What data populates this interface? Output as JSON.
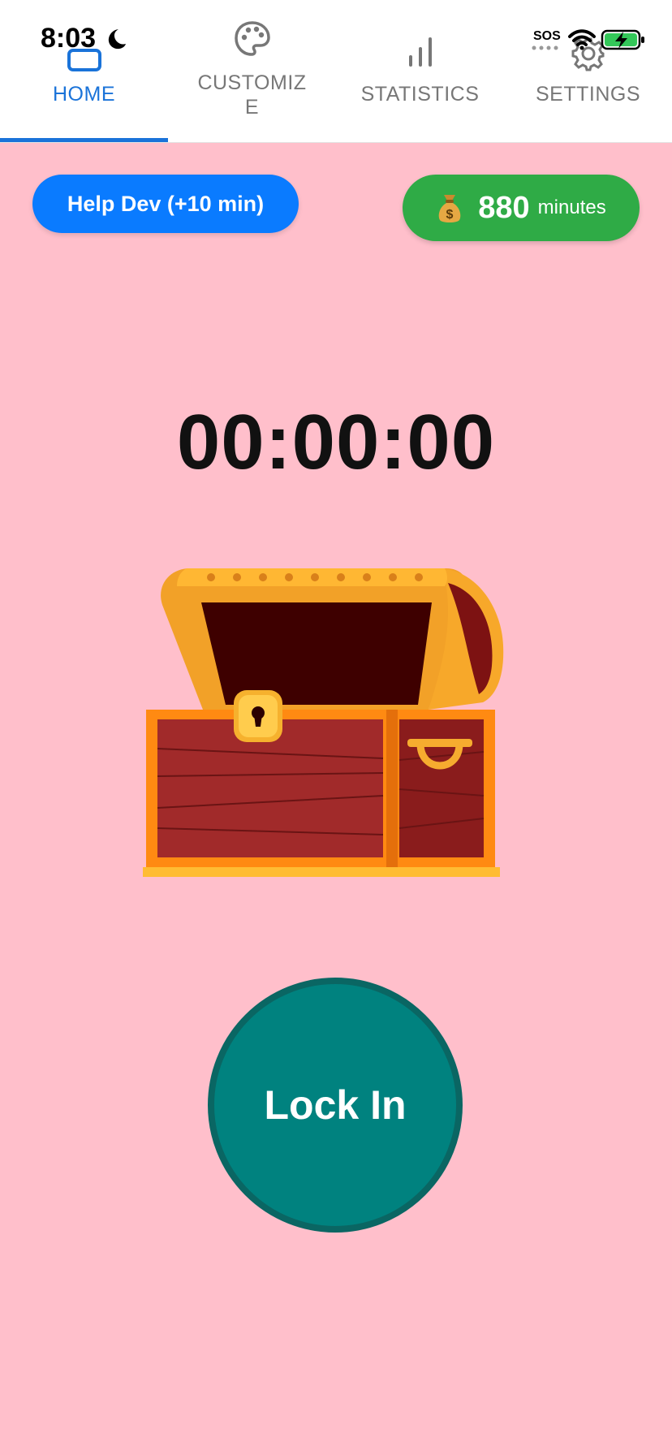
{
  "status_bar": {
    "time": "8:03",
    "sos": "SOS",
    "icons": [
      "moon-icon",
      "wifi-icon",
      "battery-charging-icon"
    ]
  },
  "tabs": [
    {
      "label": "HOME",
      "icon": "home-icon",
      "active": true
    },
    {
      "label_line1": "CUSTOMIZ",
      "label_line2": "E",
      "icon": "palette-icon",
      "active": false
    },
    {
      "label": "STATISTICS",
      "icon": "bar-chart-icon",
      "active": false
    },
    {
      "label": "SETTINGS",
      "icon": "gear-icon",
      "active": false
    }
  ],
  "help_button": {
    "label": "Help Dev (+10 min)"
  },
  "balance": {
    "icon": "money-bag-icon",
    "amount": "880",
    "unit": "minutes"
  },
  "timer": {
    "value": "00:00:00"
  },
  "illustration": {
    "icon": "treasure-chest-icon"
  },
  "lock_button": {
    "label": "Lock In"
  },
  "colors": {
    "background": "#FFBFCB",
    "accent_blue": "#0A7BFF",
    "tab_active": "#1A73D9",
    "balance_green": "#2FAB46",
    "lock_teal": "#00827F"
  }
}
